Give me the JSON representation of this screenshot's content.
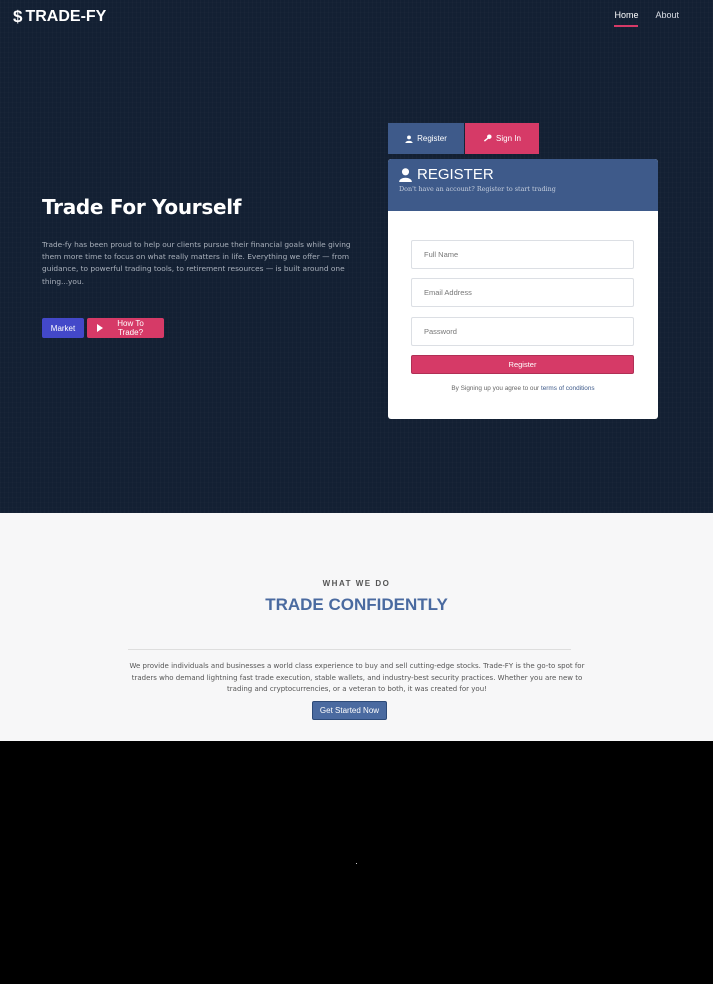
{
  "brand": {
    "icon": "dollar-icon",
    "name": "TRADE-FY",
    "symbol": "$"
  },
  "nav": {
    "home": "Home",
    "about": "About"
  },
  "hero": {
    "title": "Trade For Yourself",
    "text": "Trade-fy has been proud to help our clients pursue their financial goals while giving them more time to focus on what really matters in life. Everything we offer — from guidance, to powerful trading tools, to retirement resources — is built around one thing...you.",
    "market_label": "Market",
    "how_label": "How To Trade?"
  },
  "tabs": {
    "register": "Register",
    "signin": "Sign In"
  },
  "form": {
    "title": "REGISTER",
    "subtitle": "Don't have an account? Register to start trading",
    "full_name_placeholder": "Full Name",
    "email_placeholder": "Email Address",
    "password_placeholder": "Password",
    "submit_label": "Register",
    "terms_prefix": "By Signing up you agree to our ",
    "terms_link": "terms of conditions"
  },
  "about": {
    "eyebrow": "WHAT WE DO",
    "title": "TRADE CONFIDENTLY",
    "text": "We provide individuals and businesses a world class experience to buy and sell cutting-edge stocks. Trade-FY is the go-to spot for traders who demand lightning fast trade execution, stable wallets, and industry-best security practices. Whether you are new to trading and cryptocurrencies, or a veteran to both, it was created for you!",
    "cta_label": "Get Started Now"
  },
  "colors": {
    "accent": "#d63a67",
    "primary": "#3e5a8a",
    "market": "#4348c9",
    "hero_bg": "#132033"
  }
}
